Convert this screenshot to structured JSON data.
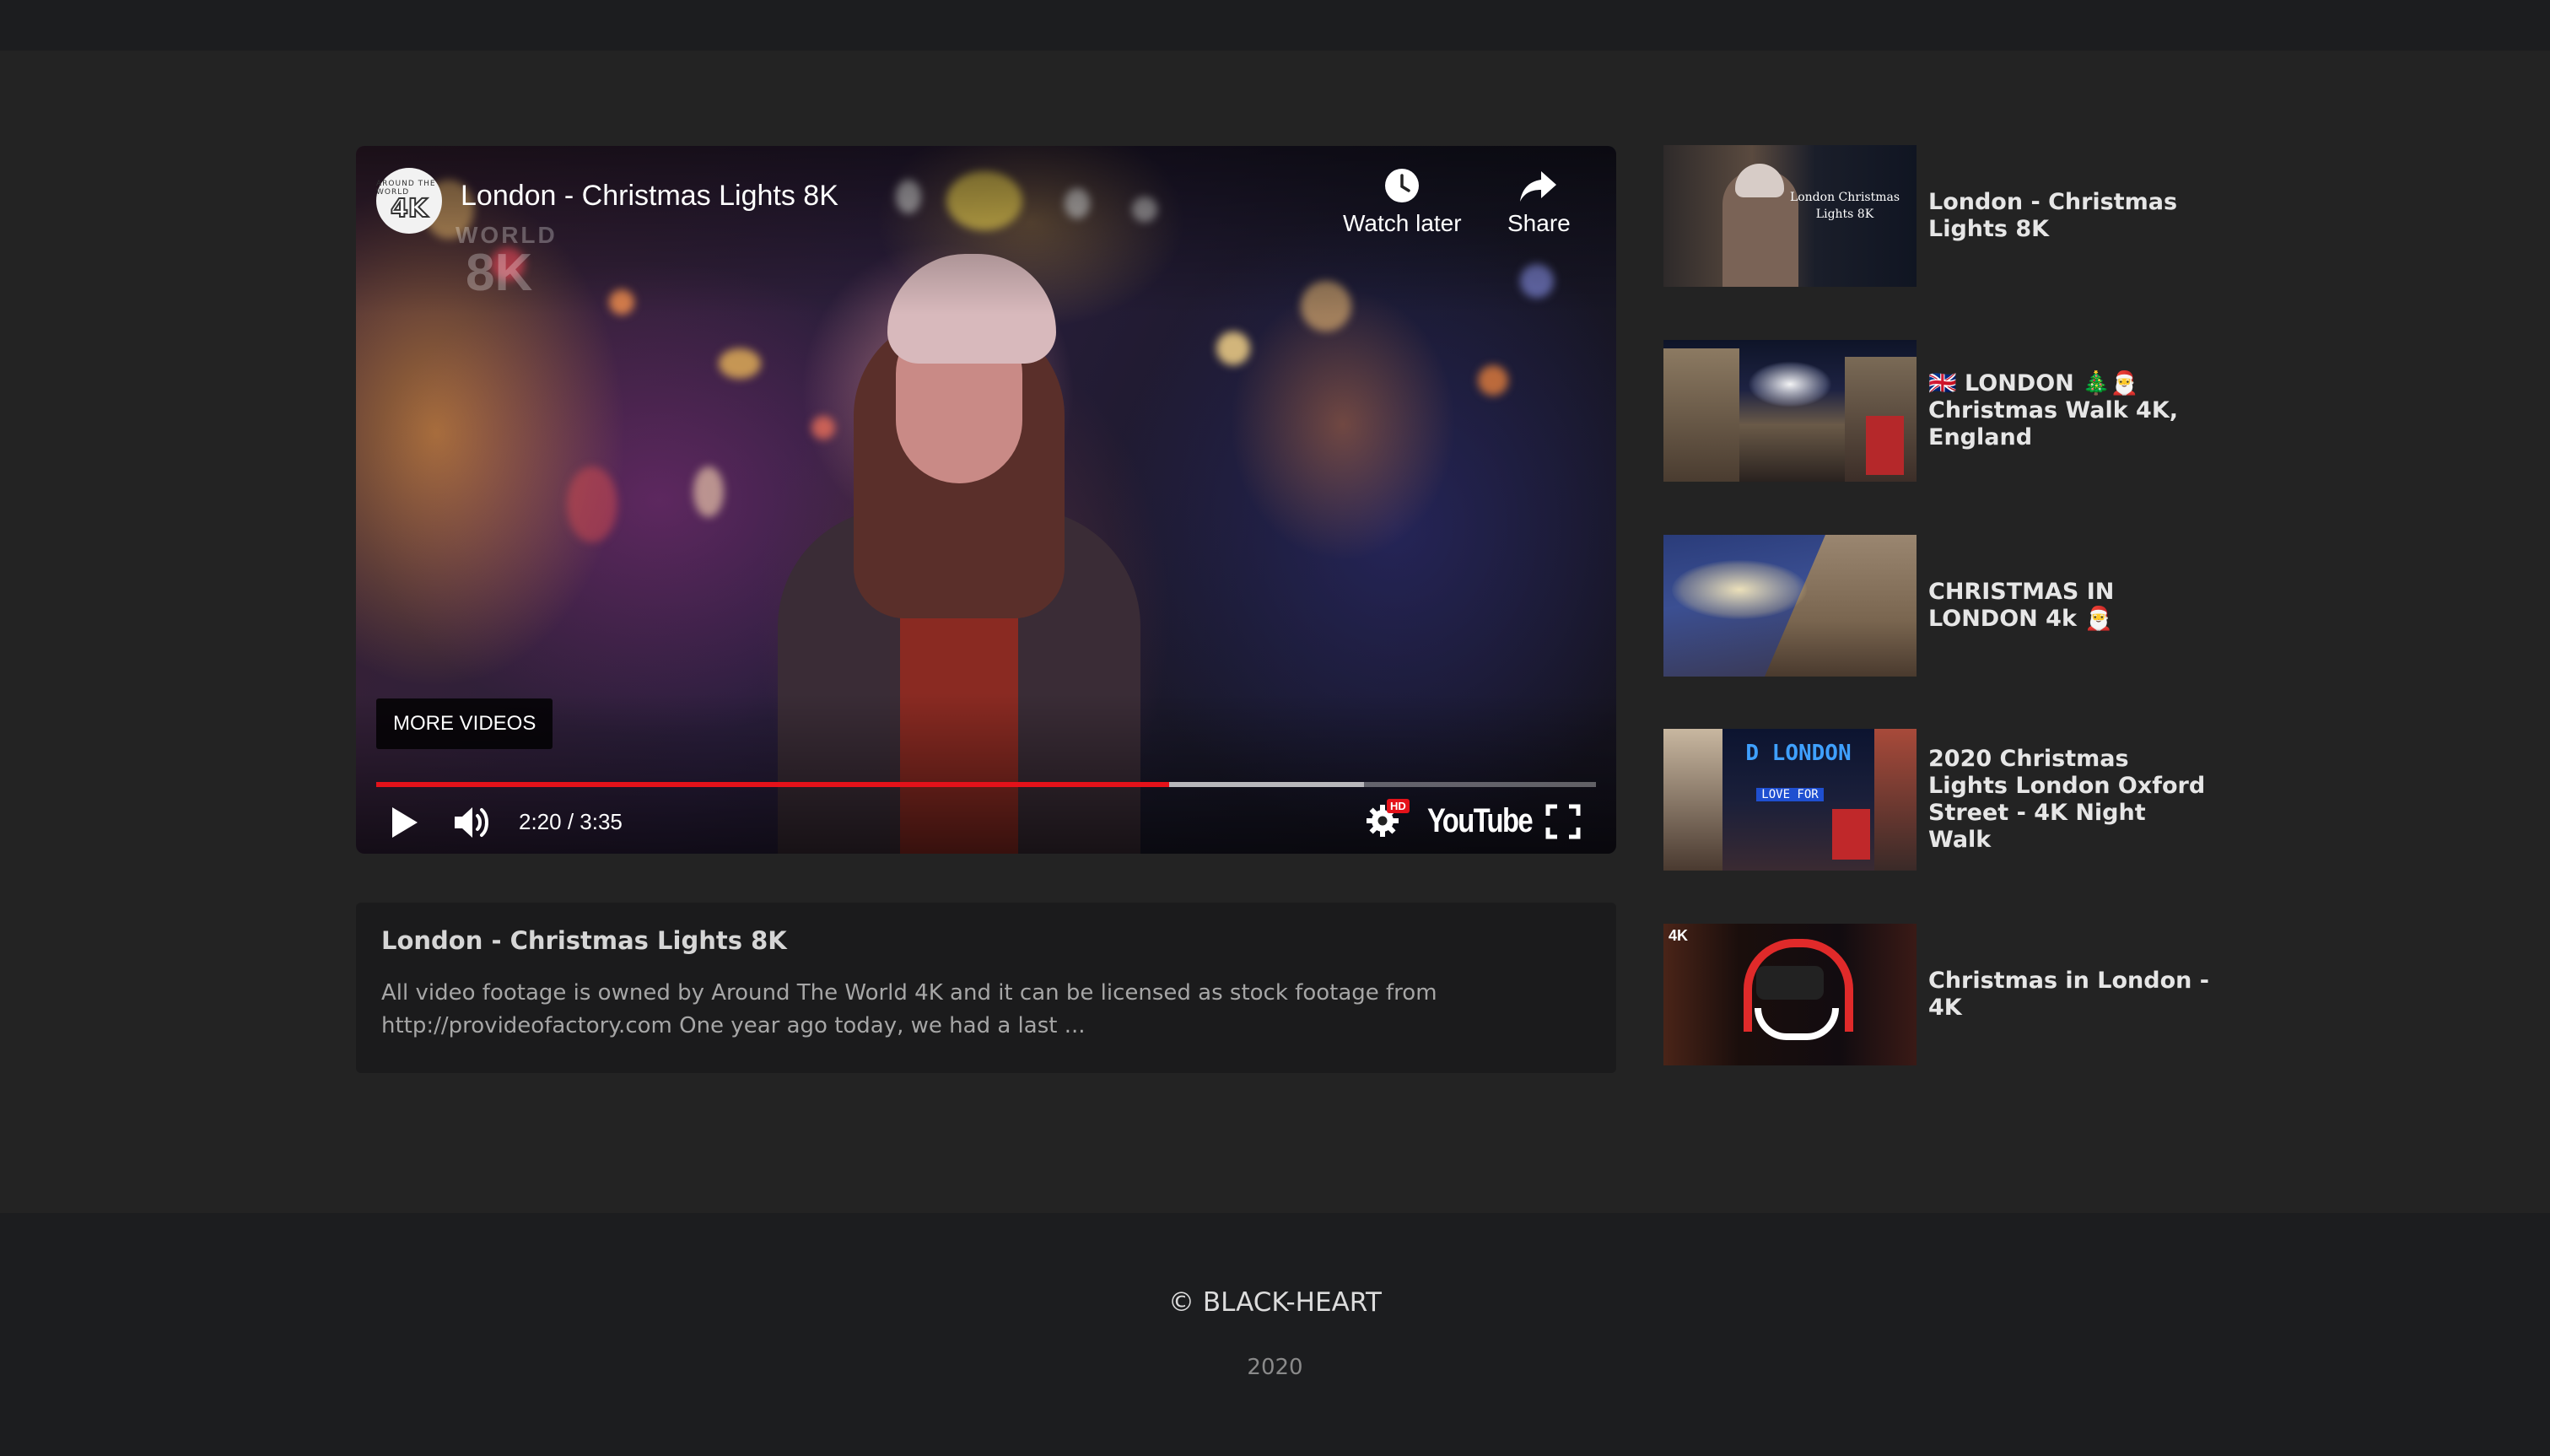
{
  "player": {
    "title": "London - Christmas Lights 8K",
    "channel_avatar": {
      "top": "AROUND THE WORLD",
      "big": "4K"
    },
    "watermark": {
      "small": "WORLD",
      "big": "8K"
    },
    "watch_later_label": "Watch later",
    "share_label": "Share",
    "more_videos_label": "MORE VIDEOS",
    "time": "2:20 / 3:35",
    "progress": 0.65,
    "buffered": 0.81,
    "hd_badge": "HD",
    "logo_text": "YouTube",
    "accent_color": "#e4121a"
  },
  "description": {
    "title": "London - Christmas Lights 8K",
    "text": "All video footage is owned by Around The World 4K and it can be licensed as stock footage from http://provideofactory.com One year ago today, we had a last ..."
  },
  "sidebar": {
    "items": [
      {
        "title": "London - Christmas Lights 8K",
        "thumb_text": "London Christmas Lights 8K"
      },
      {
        "title": "🇬🇧 LONDON 🎄🎅 Christmas Walk 4K, England"
      },
      {
        "title": "CHRISTMAS IN LONDON 4k 🎅"
      },
      {
        "title": "2020 Christmas Lights London Oxford Street - 4K Night Walk",
        "thumb_text": "D LONDON",
        "thumb_text2": "LOVE FOR"
      },
      {
        "title": "Christmas in London - 4K",
        "thumb_text": "4K"
      }
    ]
  },
  "footer": {
    "copyright": "© BLACK-HEART",
    "year": "2020"
  }
}
